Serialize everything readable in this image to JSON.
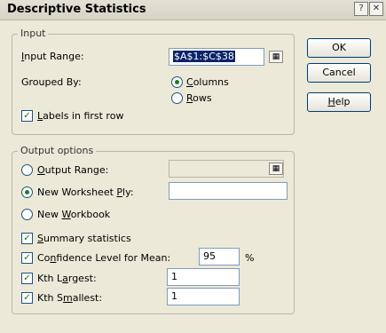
{
  "dialog": {
    "title": "Descriptive Statistics",
    "help_icon": "?",
    "close_icon": "✕"
  },
  "input_group": {
    "label": "Input",
    "input_range_label": "Input Range:",
    "input_range_value": "$A$1:$C$38",
    "grouped_by_label": "Grouped By:",
    "grouped_options": [
      "Columns",
      "Rows"
    ],
    "grouped_selected": "Columns",
    "labels_first_row": "Labels in first row",
    "labels_first_row_checked": true
  },
  "output_group": {
    "label": "Output options",
    "output_range": "Output Range:",
    "new_worksheet_ply": "New Worksheet Ply:",
    "new_workbook": "New Workbook",
    "selected": "New Worksheet Ply:",
    "summary_statistics": "Summary statistics",
    "confidence_level": "Confidence Level for Mean:",
    "confidence_value": "95",
    "percent": "%",
    "kth_largest": "Kth Largest:",
    "kth_largest_value": "1",
    "kth_smallest": "Kth Smallest:",
    "kth_smallest_value": "1"
  },
  "buttons": {
    "ok": "OK",
    "cancel": "Cancel",
    "help": "Help"
  }
}
